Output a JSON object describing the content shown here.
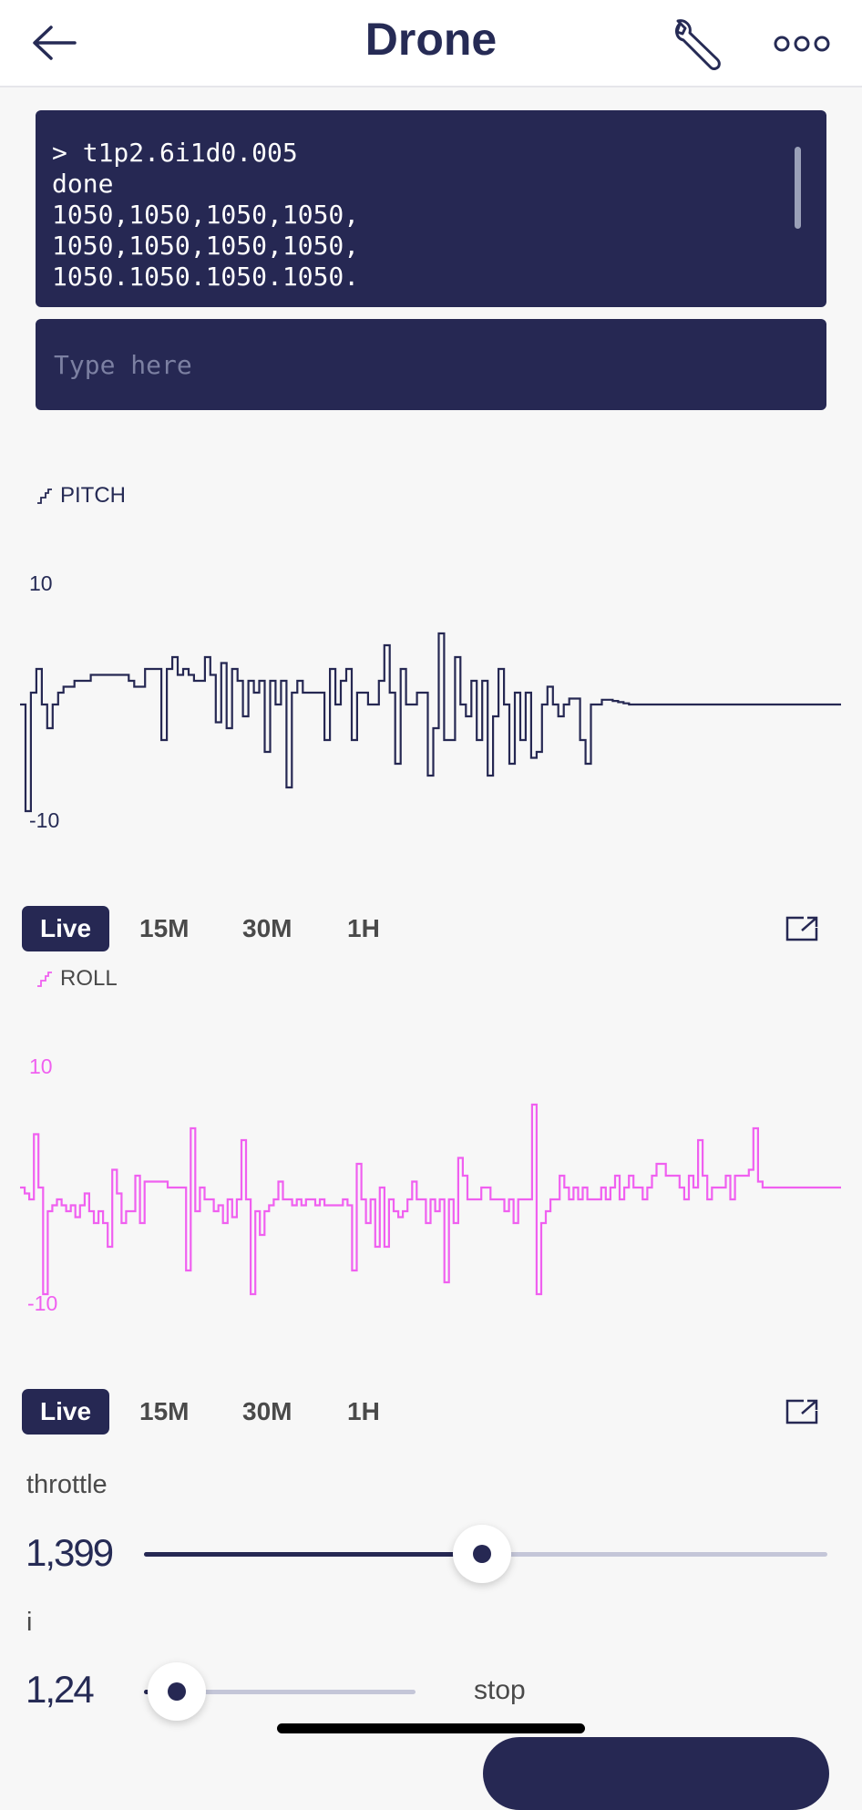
{
  "header": {
    "title": "Drone",
    "back_icon": "arrow-left-icon",
    "settings_icon": "wrench-icon",
    "more_icon": "more-dots-icon"
  },
  "terminal": {
    "lines": [
      "> t1p2.6i1d0.005",
      "done",
      "1050,1050,1050,1050,",
      "1050,1050,1050,1050,",
      "1050.1050.1050.1050."
    ],
    "input_placeholder": "Type here"
  },
  "colors": {
    "primary": "#262853",
    "roll": "#f060f0",
    "track": "#c4c6d8"
  },
  "ranges": [
    "Live",
    "15M",
    "30M",
    "1H"
  ],
  "charts": {
    "pitch": {
      "title": "PITCH",
      "ymax_label": "10",
      "ymin_label": "-10"
    },
    "roll": {
      "title": "ROLL",
      "ymax_label": "10",
      "ymin_label": "-10"
    }
  },
  "chart_data": [
    {
      "type": "line",
      "title": "PITCH",
      "ylim": [
        -10,
        10
      ],
      "series": [
        {
          "color": "#262853",
          "values": [
            0,
            -9,
            1,
            3,
            0,
            -2,
            0,
            1,
            1.5,
            1.5,
            2,
            2,
            2,
            2.5,
            2.5,
            2.5,
            2.5,
            2.5,
            2.5,
            2.5,
            2,
            1.5,
            1.5,
            3,
            3,
            3,
            -3,
            3,
            4,
            2.5,
            3,
            2.5,
            2,
            2,
            4,
            2.5,
            -1.5,
            3.5,
            -2,
            3,
            2,
            -1,
            2,
            1,
            2,
            -4,
            2,
            0,
            2,
            -7,
            1,
            2,
            1,
            1,
            1,
            1,
            -3,
            3,
            0,
            2,
            3,
            -3,
            1,
            1,
            0,
            0,
            2,
            5,
            1,
            -5,
            3,
            0,
            0,
            1,
            1,
            -6,
            -2,
            6,
            -3,
            -3,
            4,
            0,
            -1,
            2,
            -3,
            2,
            -6,
            -1,
            3,
            0,
            -5,
            1,
            -3,
            1,
            -4.5,
            -4,
            0,
            1.5,
            0,
            -1,
            0,
            0.5,
            0.5,
            -3,
            -5,
            0,
            0,
            0.4,
            0.4,
            0.3,
            0.2,
            0.1,
            0,
            0,
            0,
            0,
            0,
            0,
            0,
            0,
            0,
            0,
            0,
            0,
            0,
            0,
            0,
            0,
            0,
            0,
            0,
            0,
            0,
            0,
            0,
            0,
            0,
            0,
            0,
            0,
            0,
            0,
            0,
            0,
            0,
            0,
            0,
            0,
            0,
            0,
            0
          ]
        }
      ]
    },
    {
      "type": "line",
      "title": "ROLL",
      "ylim": [
        -10,
        10
      ],
      "series": [
        {
          "color": "#f060f0",
          "values": [
            0,
            -0.5,
            -1,
            4.5,
            0,
            -9,
            -2,
            -1.5,
            -1,
            -1.5,
            -2,
            -1.5,
            -2.5,
            -1.5,
            -0.5,
            -2,
            -3,
            -2,
            -3,
            -5,
            1.5,
            -0.5,
            -3,
            -2,
            -2,
            1,
            -3,
            0.5,
            0.5,
            0.5,
            0.5,
            0.5,
            0,
            0,
            0,
            0,
            -7,
            5,
            -2,
            0,
            -1,
            -1,
            -2,
            -1.5,
            -3,
            -1,
            -2.5,
            -1,
            4,
            -1,
            -9,
            -2,
            -4,
            -2,
            -1.5,
            -1,
            0.5,
            -1,
            -1,
            -1.5,
            -1,
            -1.5,
            -1,
            -1,
            -1.5,
            -1,
            -1.5,
            -1.5,
            -1.5,
            -1.5,
            -1,
            -1.5,
            -7,
            2,
            -1,
            -3,
            -1,
            -5,
            0,
            -5,
            -1,
            -2,
            -2.5,
            -2,
            -1,
            0.5,
            -1,
            -1,
            -3,
            -1,
            -2,
            -1,
            -8,
            -1,
            -3,
            2.5,
            1,
            -1,
            -1,
            -1,
            0,
            0,
            -1,
            -1,
            -1,
            -2,
            -1,
            -3,
            -1,
            -1,
            -1,
            7,
            -9,
            -3,
            -2,
            -1,
            -1,
            1,
            0,
            -1,
            0,
            -1,
            0,
            -1,
            -1,
            -1,
            0,
            -1,
            0,
            1,
            -1,
            0,
            1,
            0,
            0,
            -1,
            0,
            1,
            2,
            2,
            1,
            1,
            1,
            0,
            -1,
            1,
            0,
            4,
            1,
            -1,
            0,
            0,
            0,
            1,
            -1,
            1,
            1,
            1,
            1.5,
            5,
            0.5,
            0,
            0,
            0,
            0,
            0,
            0,
            0,
            0,
            0,
            0,
            0,
            0,
            0,
            0,
            0,
            0,
            0
          ]
        }
      ]
    }
  ],
  "controls": {
    "throttle": {
      "label": "throttle",
      "value": "1,399",
      "fraction": 0.495
    },
    "i": {
      "label": "i",
      "value": "1,24",
      "fraction": 0.12,
      "end_label": "stop"
    }
  }
}
